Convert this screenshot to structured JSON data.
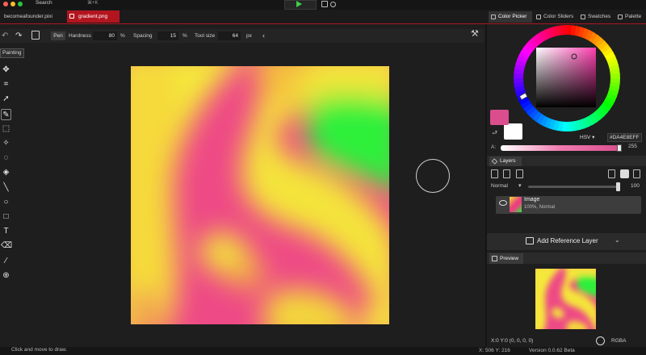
{
  "titlebar": {
    "search_label": "Search",
    "search_shortcut": "⌘+K"
  },
  "tabs": [
    {
      "label": "becomeafounder.pixi"
    },
    {
      "label": "gradient.png"
    }
  ],
  "panel_tabs": [
    {
      "label": "Color Picker",
      "active": true
    },
    {
      "label": "Color Sliders"
    },
    {
      "label": "Swatches"
    },
    {
      "label": "Palette"
    }
  ],
  "options": {
    "mode": "Pen",
    "hardness_label": "Hardness",
    "hardness_value": "80",
    "spacing_label": "Spacing",
    "spacing_value": "15",
    "toolsize_label": "Tool size",
    "toolsize_value": "64",
    "percent": "%",
    "px": "px"
  },
  "toolbar": {
    "section_label": "Painting",
    "tools": [
      "move-icon",
      "crop-icon",
      "select-arrow-icon",
      "pen-icon",
      "marquee-icon",
      "magic-wand-icon",
      "lasso-icon",
      "fill-bucket-icon",
      "line-icon",
      "ellipse-icon",
      "rectangle-icon",
      "text-icon",
      "eraser-icon",
      "eyedropper-icon",
      "zoom-icon"
    ]
  },
  "color": {
    "foreground": "#DA4E8E",
    "background": "#FFFFFF",
    "mode": "HSV",
    "hex": "#DA4E8EFF",
    "alpha_label": "A:",
    "alpha_value": "255"
  },
  "layers": {
    "tab_label": "Layers",
    "blend_mode": "Normal",
    "opacity": "100",
    "items": [
      {
        "name": "Image",
        "details": "100%, Normal"
      }
    ],
    "add_reference_label": "Add Reference Layer"
  },
  "preview": {
    "tab_label": "Preview"
  },
  "statusbar": {
    "hint": "Click and move to draw.",
    "position_readout": "X:0 Y:0   (0, 0, 0, 0)",
    "rgba_label": "RGBA",
    "cursor_readout": "X: 506 Y: 216",
    "version": "Version 0.0.62 Beta"
  }
}
